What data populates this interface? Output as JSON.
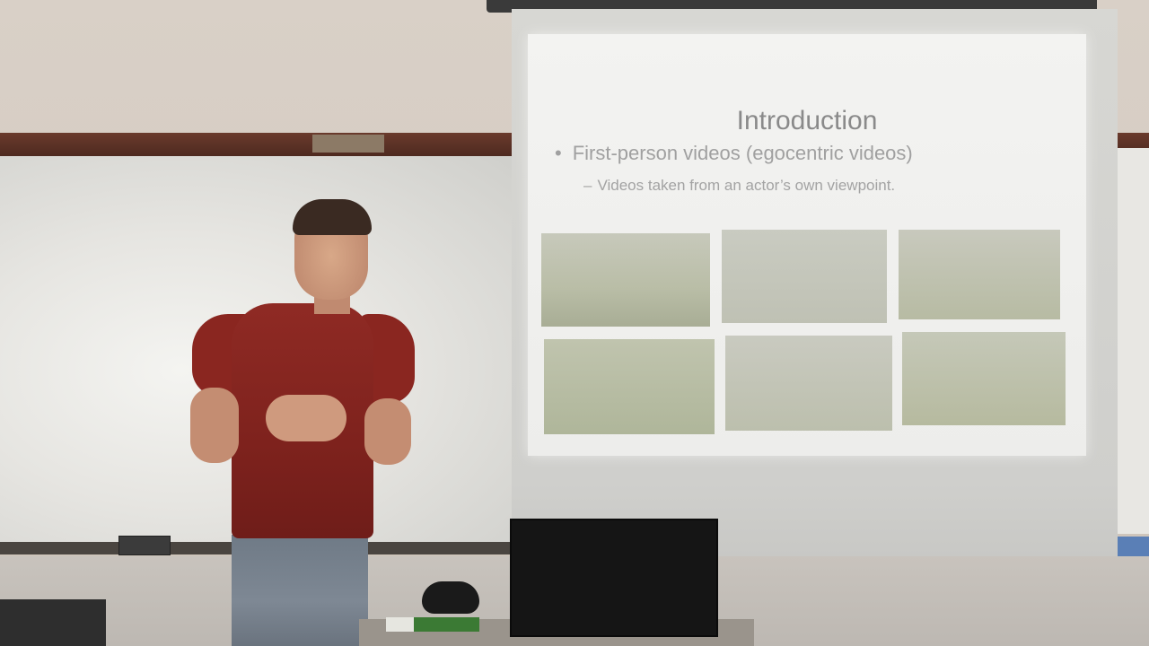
{
  "slide": {
    "title": "Introduction",
    "bullet": "First-person videos (egocentric videos)",
    "bullet_marker": "•",
    "sub_bullet": "Videos taken from an actor’s own viewpoint.",
    "sub_bullet_marker": "–"
  },
  "colors": {
    "shirt": "#8a2620",
    "slide_background": "#efefed",
    "slide_text": "#9a9a9a",
    "wall_rail": "#5a3024"
  },
  "icons": {
    "laptop": "laptop-icon",
    "mouse": "mouse-icon"
  }
}
